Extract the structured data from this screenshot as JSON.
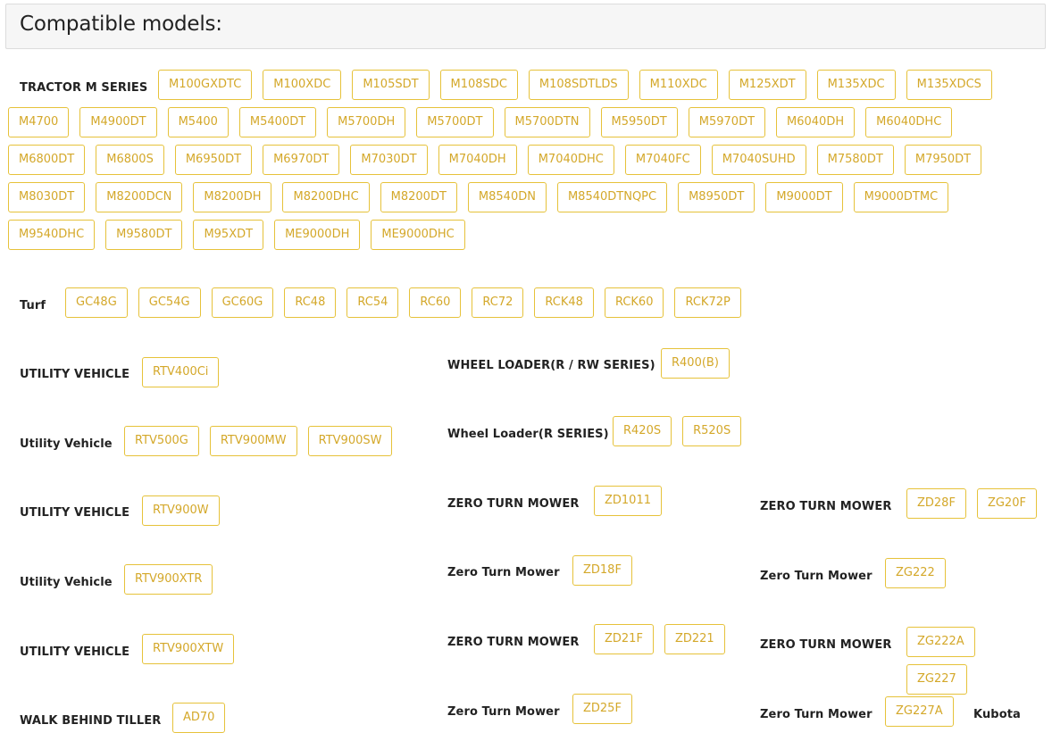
{
  "title": "Compatible models:",
  "groups": [
    {
      "id": "tractor-m",
      "label": "TRACTOR M SERIES",
      "models": [
        "M100GXDTC",
        "M100XDC",
        "M105SDT",
        "M108SDC",
        "M108SDTLDS",
        "M110XDC",
        "M125XDT",
        "M135XDC",
        "M135XDCS",
        "M4700",
        "M4900DT",
        "M5400",
        "M5400DT",
        "M5700DH",
        "M5700DT",
        "M5700DTN",
        "M5950DT",
        "M5970DT",
        "M6040DH",
        "M6040DHC",
        "M6800DT",
        "M6800S",
        "M6950DT",
        "M6970DT",
        "M7030DT",
        "M7040DH",
        "M7040DHC",
        "M7040FC",
        "M7040SUHD",
        "M7580DT",
        "M7950DT",
        "M8030DT",
        "M8200DCN",
        "M8200DH",
        "M8200DHC",
        "M8200DT",
        "M8540DN",
        "M8540DTNQPC",
        "M8950DT",
        "M9000DT",
        "M9000DTMC",
        "M9540DHC",
        "M9580DT",
        "M95XDT",
        "ME9000DH",
        "ME9000DHC"
      ]
    },
    {
      "id": "turf",
      "label": "Turf",
      "models": [
        "GC48G",
        "GC54G",
        "GC60G",
        "RC48",
        "RC54",
        "RC60",
        "RC72",
        "RCK48",
        "RCK60",
        "RCK72P"
      ]
    },
    {
      "id": "uv-1",
      "label": "UTILITY VEHICLE",
      "models": [
        "RTV400Ci"
      ]
    },
    {
      "id": "wl-1",
      "label": "WHEEL LOADER(R / RW SERIES)",
      "models": [
        "R400(B)"
      ]
    },
    {
      "id": "uv-2",
      "label": "Utility Vehicle",
      "models": [
        "RTV500G",
        "RTV900MW",
        "RTV900SW"
      ]
    },
    {
      "id": "wl-2",
      "label": "Wheel Loader(R SERIES)",
      "models": [
        "R420S",
        "R520S"
      ]
    },
    {
      "id": "uv-3",
      "label": "UTILITY VEHICLE",
      "models": [
        "RTV900W"
      ]
    },
    {
      "id": "ztm-1",
      "label": "ZERO TURN MOWER",
      "models": [
        "ZD1011"
      ]
    },
    {
      "id": "ztm-2",
      "label": "ZERO TURN MOWER",
      "models": [
        "ZD28F",
        "ZG20F"
      ]
    },
    {
      "id": "uv-4",
      "label": "Utility Vehicle",
      "models": [
        "RTV900XTR"
      ]
    },
    {
      "id": "ztm-3",
      "label": "Zero Turn Mower",
      "models": [
        "ZD18F"
      ]
    },
    {
      "id": "ztm-4",
      "label": "Zero Turn Mower",
      "models": [
        "ZG222"
      ]
    },
    {
      "id": "uv-5",
      "label": "UTILITY VEHICLE",
      "models": [
        "RTV900XTW"
      ]
    },
    {
      "id": "ztm-5",
      "label": "ZERO TURN MOWER",
      "models": [
        "ZD21F",
        "ZD221"
      ]
    },
    {
      "id": "ztm-6",
      "label": "ZERO TURN MOWER",
      "models": [
        "ZG222A",
        "ZG227"
      ]
    },
    {
      "id": "tiller",
      "label": "WALK BEHIND TILLER",
      "models": [
        "AD70"
      ]
    },
    {
      "id": "ztm-7",
      "label": "Zero Turn Mower",
      "models": [
        "ZD25F"
      ]
    },
    {
      "id": "ztm-8",
      "label": "Zero Turn Mower",
      "models": [
        "ZG227A"
      ]
    }
  ],
  "trailing_text": "Kubota"
}
